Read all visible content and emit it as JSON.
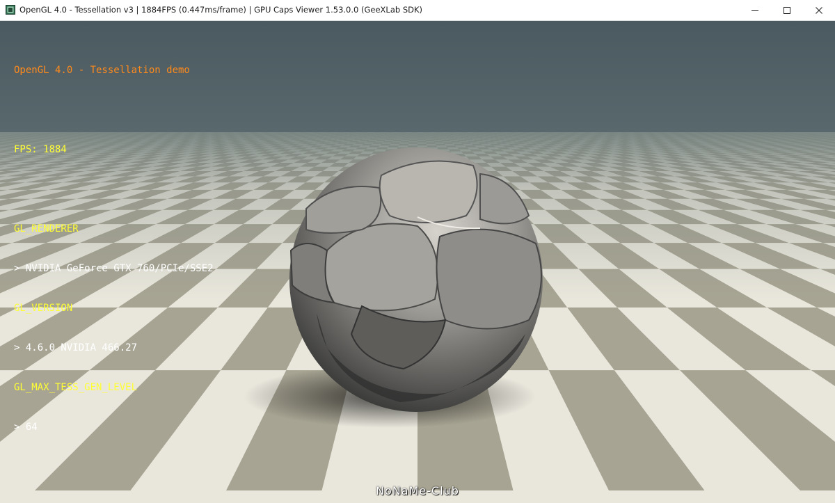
{
  "window": {
    "title": "OpenGL 4.0 - Tessellation v3 | 1884FPS (0.447ms/frame) | GPU Caps Viewer 1.53.0.0 (GeeXLab SDK)",
    "app_icon": "gpu-caps-app-icon",
    "controls": [
      "minimize-icon",
      "maximize-icon",
      "close-icon"
    ]
  },
  "hud": {
    "demo_title": "OpenGL 4.0 - Tessellation demo",
    "fps_line": "FPS: 1884",
    "renderer_label": "GL_RENDERER",
    "renderer_value": "> NVIDIA GeForce GTX 760/PCIe/SSE2",
    "version_label": "GL_VERSION",
    "version_value": "> 4.6.0 NVIDIA 466.27",
    "tess_label": "GL_MAX_TESS_GEN_LEVEL",
    "tess_value": "> 64"
  },
  "watermark": "NoNaMe-Club",
  "colors": {
    "hud_title": "#ff8a1c",
    "hud_label": "#ffff33",
    "hud_value": "#ffffff",
    "floor_light": "#e9e7dc",
    "floor_dark": "#a7a493",
    "sky": "#5e6f74",
    "rock": "#8d8c89"
  }
}
